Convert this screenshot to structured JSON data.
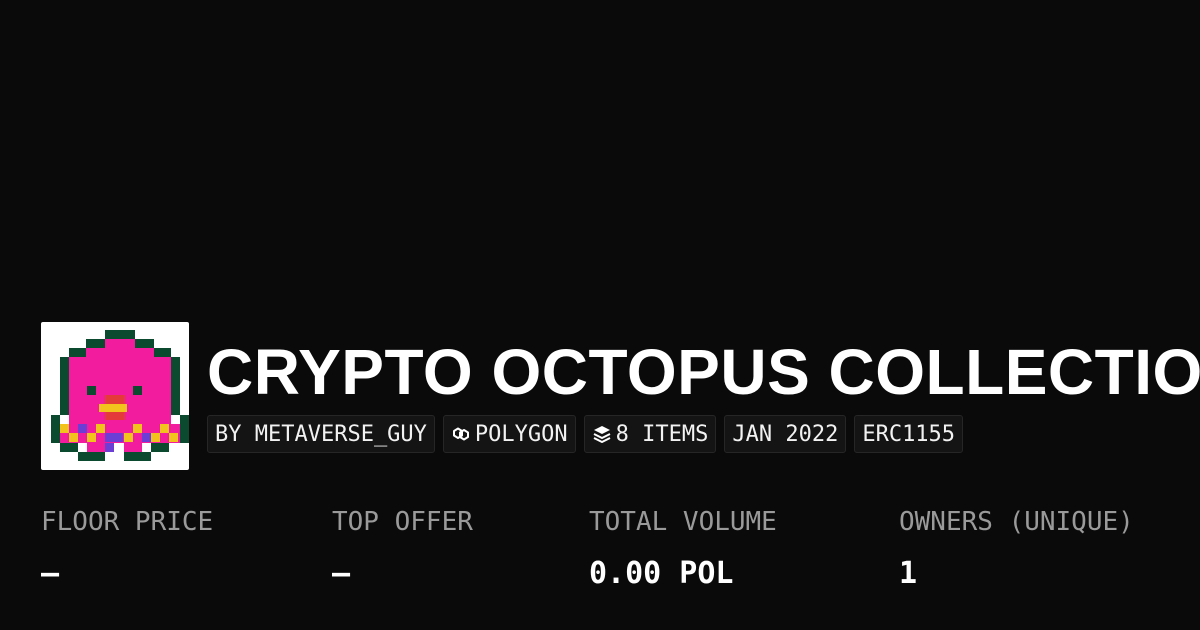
{
  "collection": {
    "title": "CRYPTO OCTOPUS COLLECTION",
    "avatar_icon": "octopus-pixel-art"
  },
  "tags": [
    {
      "label": "BY METAVERSE_GUY",
      "icon": ""
    },
    {
      "label": "POLYGON",
      "icon": "polygon-chain-icon"
    },
    {
      "label": "8 ITEMS",
      "icon": "layers-icon"
    },
    {
      "label": "JAN 2022",
      "icon": ""
    },
    {
      "label": "ERC1155",
      "icon": ""
    }
  ],
  "stats": [
    {
      "label": "FLOOR PRICE",
      "value": "–"
    },
    {
      "label": "TOP OFFER",
      "value": "–"
    },
    {
      "label": "TOTAL VOLUME",
      "value": "0.00 POL"
    },
    {
      "label": "OWNERS (UNIQUE)",
      "value": "1"
    }
  ],
  "colors": {
    "background": "#0a0a0a",
    "octopus_body": "#f21d9e",
    "octopus_outline": "#0b4a2e",
    "beak": "#f2c21d",
    "text_muted": "#9a9a9a"
  }
}
